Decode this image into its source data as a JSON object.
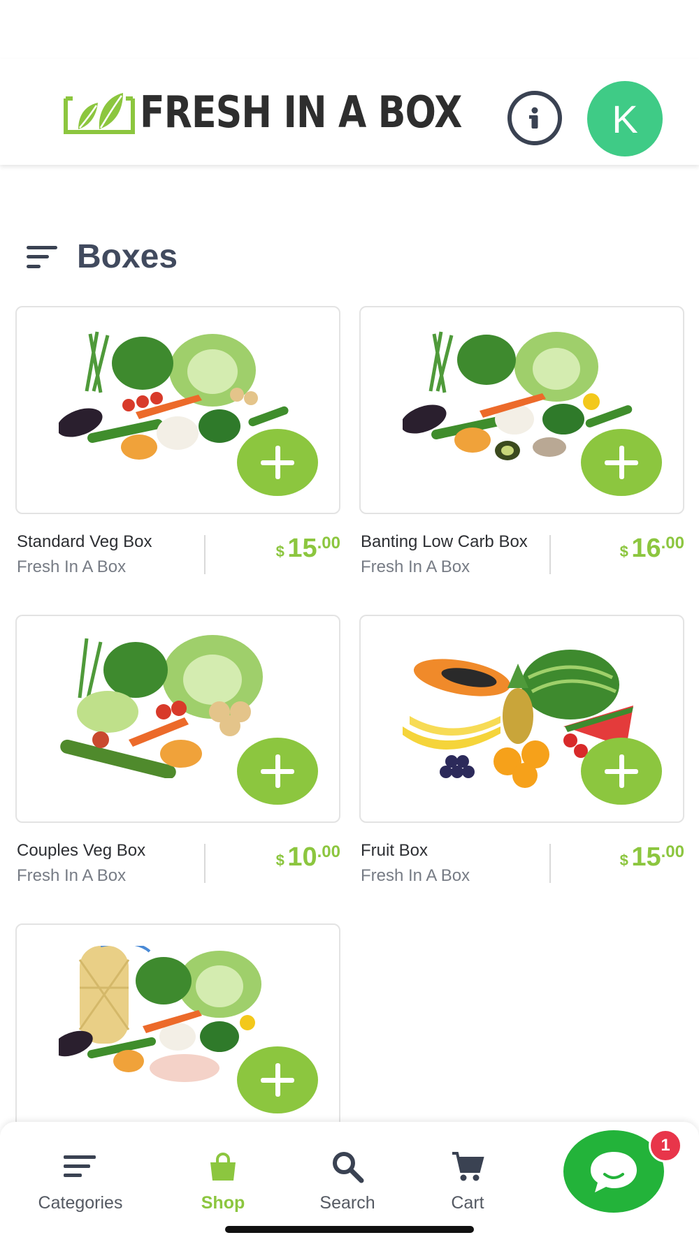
{
  "header": {
    "logo_text": "FRESH IN A BOX",
    "avatar_initial": "K"
  },
  "section": {
    "title": "Boxes"
  },
  "products": [
    {
      "name": "Standard Veg Box",
      "brand": "Fresh In A Box",
      "currency": "$",
      "price_whole": "15",
      "price_cents": ".00",
      "image": "vegetable-box-image"
    },
    {
      "name": "Banting Low Carb Box",
      "brand": "Fresh In A Box",
      "currency": "$",
      "price_whole": "16",
      "price_cents": ".00",
      "image": "low-carb-box-image"
    },
    {
      "name": "Couples Veg Box",
      "brand": "Fresh In A Box",
      "currency": "$",
      "price_whole": "10",
      "price_cents": ".00",
      "image": "vegetable-box-image"
    },
    {
      "name": "Fruit Box",
      "brand": "Fresh In A Box",
      "currency": "$",
      "price_whole": "15",
      "price_cents": ".00",
      "image": "fruit-box-image"
    },
    {
      "name": "",
      "brand": "",
      "image": "potato-chicken-box-image"
    }
  ],
  "bottom_nav": {
    "items": [
      {
        "label": "Categories",
        "icon": "menu-icon"
      },
      {
        "label": "Shop",
        "icon": "shopping-bag-icon",
        "active": true
      },
      {
        "label": "Search",
        "icon": "search-icon"
      },
      {
        "label": "Cart",
        "icon": "cart-icon"
      }
    ]
  },
  "chat": {
    "icon": "chat-bubble-icon",
    "badge_count": "1"
  },
  "colors": {
    "accent_green": "#8cc63f",
    "avatar_green": "#3fcb86",
    "chat_green": "#23b33a",
    "badge_red": "#e8354a",
    "dark_text": "#414a5e"
  }
}
